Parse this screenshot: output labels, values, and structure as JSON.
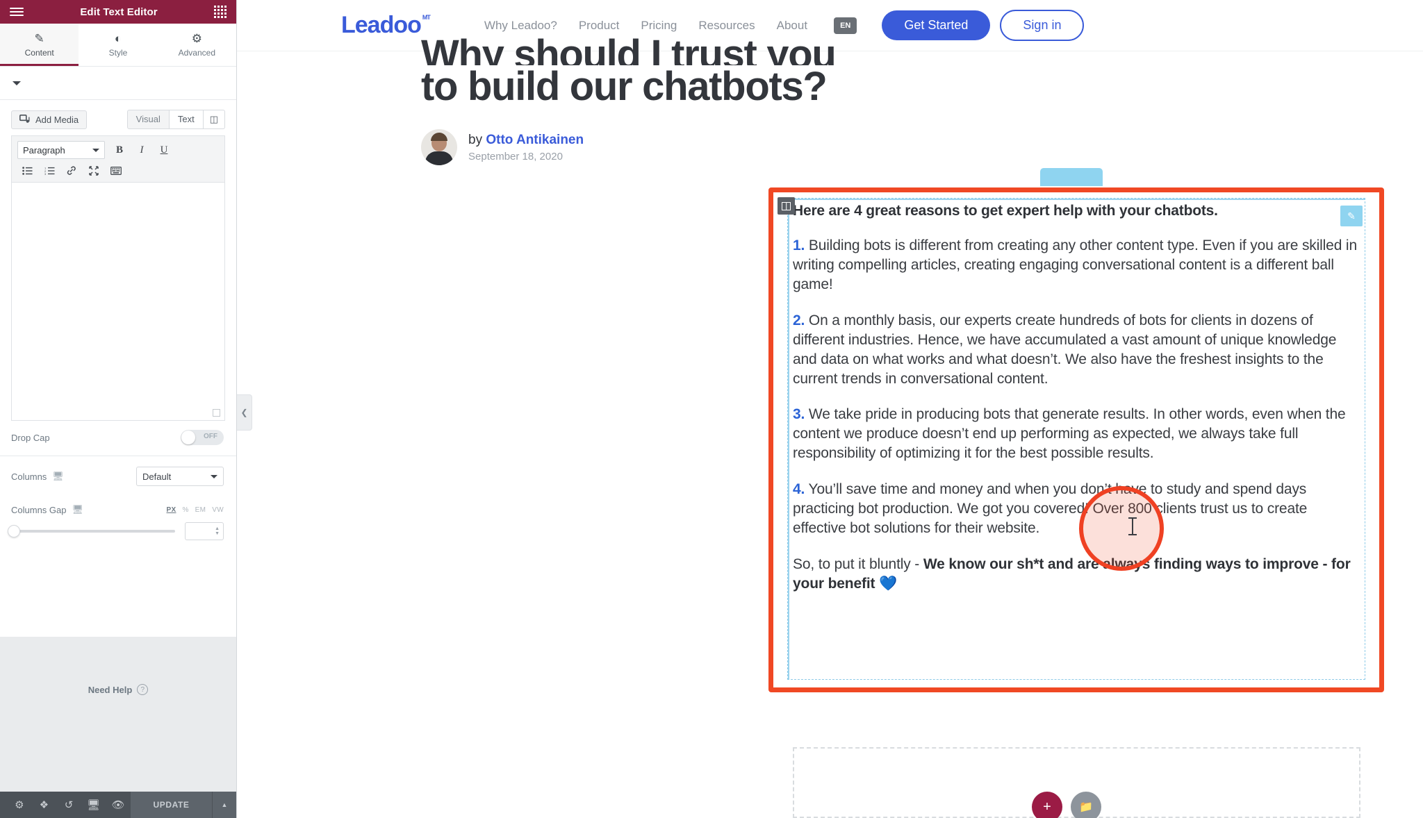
{
  "panel": {
    "header": {
      "title": "Edit Text Editor",
      "menu_icon": "hamburger-icon",
      "apps_icon": "grid-icon"
    },
    "tabs": [
      {
        "label": "Content",
        "icon": "pencil-icon",
        "active": true
      },
      {
        "label": "Style",
        "icon": "contrast-icon",
        "active": false
      },
      {
        "label": "Advanced",
        "icon": "gear-icon",
        "active": false
      }
    ],
    "editor": {
      "add_media_label": "Add Media",
      "add_media_icon": "media-icon",
      "mode_tabs": [
        "Visual",
        "Text"
      ],
      "active_mode": "Visual",
      "database_icon": "database-icon",
      "format_select": "Paragraph",
      "bold_label": "B",
      "italic_label": "I",
      "underline_label": "U",
      "bullet_list_icon": "bullet-list-icon",
      "numbered_list_icon": "numbered-list-icon",
      "link_icon": "link-icon",
      "fullscreen_icon": "fullscreen-icon",
      "toolbar_toggle_icon": "keyboard-toolbar-icon",
      "content_value": "",
      "content_placeholder": ""
    },
    "controls": {
      "drop_cap_label": "Drop Cap",
      "drop_cap_state": "OFF",
      "columns_label": "Columns",
      "columns_value": "Default",
      "columns_gap_label": "Columns Gap",
      "units": [
        "PX",
        "%",
        "EM",
        "VW"
      ],
      "active_unit": "PX",
      "gap_value": "",
      "device_icon": "desktop-icon"
    },
    "help": {
      "label": "Need Help",
      "icon": "question-icon"
    },
    "footer": {
      "icons": [
        "settings-gear-icon",
        "navigator-layers-icon",
        "history-icon",
        "responsive-desktop-icon",
        "preview-eye-icon"
      ],
      "update_label": "UPDATE",
      "update_caret_icon": "chevron-up-icon"
    },
    "collapse_icon": "chevron-left-icon"
  },
  "site": {
    "logo": {
      "text": "Leadoo",
      "superscript": "MT"
    },
    "nav": [
      "Why Leadoo?",
      "Product",
      "Pricing",
      "Resources",
      "About"
    ],
    "language_badge": "EN",
    "cta_primary": "Get Started",
    "cta_secondary": "Sign in",
    "brand_color": "#3a5bd9"
  },
  "article": {
    "title_clipped_line": "Why should I trust you",
    "title_line": "to build our chatbots?",
    "byline_prefix": "by",
    "author": "Otto Antikainen",
    "date": "September 18, 2020",
    "avatar": "author-avatar"
  },
  "text_widget": {
    "lead": "Here are 4 great reasons to get expert help with your chatbots.",
    "items": [
      {
        "num": "1.",
        "text": "Building bots is different from creating any other content type. Even if you are skilled in writing compelling articles, creating engaging conversational content is a different ball game!"
      },
      {
        "num": "2.",
        "text": "On a monthly basis, our experts create hundreds of bots for clients in dozens of different industries. Hence, we have accumulated a vast amount of unique knowledge and data on what works and what doesn’t. We also have the freshest insights to the current trends in conversational content."
      },
      {
        "num": "3.",
        "text": "We take pride in producing bots that generate results. In other words, even when the content we produce doesn’t end up performing as expected, we always take full responsibility of optimizing it for the best possible results."
      },
      {
        "num": "4.",
        "text": "You’ll save time and money and when you don’t have to study and spend days practicing bot production. We got you covered! Over 800 clients trust us to create effective bot solutions for their website."
      }
    ],
    "closing_plain": "So, to put it bluntly - ",
    "closing_bold": "We know our sh*t and are always finding ways to improve - for your benefit",
    "closing_emoji": "💙",
    "selection_color": "#f04824",
    "handle_icon": "widget-drag-handle-icon",
    "edit_icon": "pencil-edit-icon"
  },
  "canvas": {
    "add_section_icon": "plus-icon",
    "add_template_icon": "folder-icon",
    "cursor_icon": "text-ibeam-cursor",
    "click_indicator": "click-highlight-ring"
  }
}
